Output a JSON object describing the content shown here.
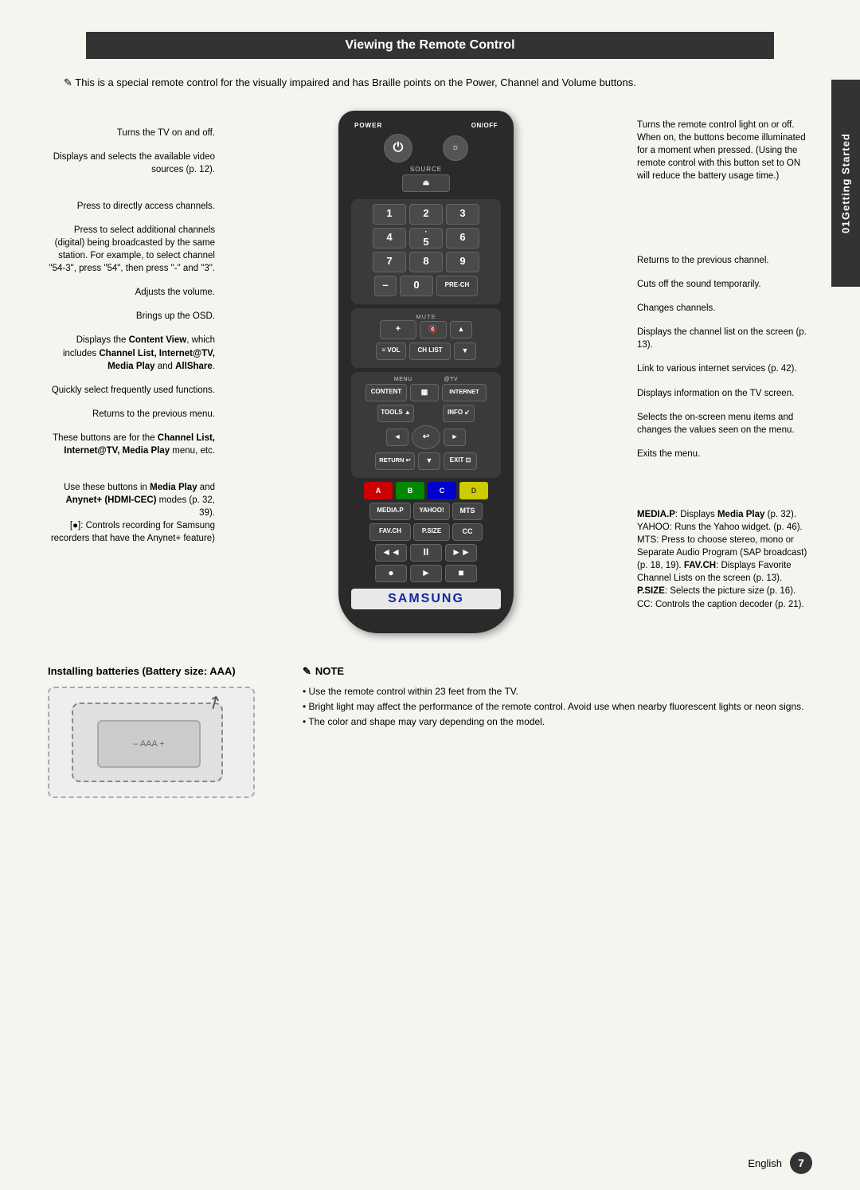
{
  "page": {
    "background": "#f5f5f0",
    "side_tab": {
      "number": "01",
      "text": "Getting Started"
    },
    "section_title": "Viewing the Remote Control",
    "intro_text": "This is a special remote control for the visually impaired and has Braille points on the Power, Channel and Volume buttons.",
    "left_labels": [
      {
        "text": "Turns the TV on and off."
      },
      {
        "text": "Displays and selects the available video sources (p. 12)."
      },
      {
        "text": "Press to directly access channels."
      },
      {
        "text": "Press to select additional channels (digital) being broadcasted by the same station. For example, to select channel \"54-3\", press \"54\", then press \"-\" and \"3\"."
      },
      {
        "text": "Adjusts the volume."
      },
      {
        "text": "Brings up the OSD."
      },
      {
        "text": "Displays the Content View, which includes Channel List, Internet@TV, Media Play and AllShare."
      },
      {
        "text": "Quickly select frequently used functions."
      },
      {
        "text": "Returns to the previous menu."
      },
      {
        "text": "These buttons are for the Channel List, Internet@TV, Media Play menu, etc."
      },
      {
        "text": "Use these buttons in Media Play and Anynet+ (HDMI-CEC) modes (p. 32, 39).\n[●]: Controls recording for Samsung recorders that have the Anynet+ feature)"
      }
    ],
    "right_labels": [
      {
        "text": "Turns the remote control light on or off. When on, the buttons become illuminated for a moment when pressed. (Using the remote control with this button set to ON will reduce the battery usage time.)"
      },
      {
        "text": "Returns to the previous channel."
      },
      {
        "text": "Cuts off the sound temporarily."
      },
      {
        "text": "Changes channels."
      },
      {
        "text": "Displays the channel list on the screen (p. 13)."
      },
      {
        "text": "Link to various internet services (p. 42)."
      },
      {
        "text": "Displays information on the TV screen."
      },
      {
        "text": "Selects the on-screen menu items and changes the values seen on the menu."
      },
      {
        "text": "Exits the menu."
      },
      {
        "text": "MEDIA.P: Displays Media Play (p. 32). YAHOO: Runs the Yahoo widget. (p. 46). MTS: Press to choose stereo, mono or Separate Audio Program (SAP broadcast) (p. 18, 19). FAV.CH: Displays Favorite Channel Lists on the screen (p. 13). P.SIZE: Selects the picture size (p. 16). CC: Controls the caption decoder (p. 21)."
      }
    ],
    "remote": {
      "power_label": "POWER",
      "onoff_label": "ON/OFF",
      "source_label": "SOURCE",
      "buttons": {
        "num1": "1",
        "num2": "2",
        "num3": "3",
        "num4": "4",
        "num5": "5",
        "num6": "6",
        "num7": "7",
        "num8": "8",
        "num9": "9",
        "dash": "–",
        "num0": "0",
        "prech": "PRE-CH",
        "mute": "MUTE",
        "vol": "VOL",
        "chlist": "CH LIST",
        "menu": "MENU",
        "atv": "@TV",
        "content": "CONTENT",
        "menu_icon": "▦",
        "internet": "INTERNET",
        "tools": "TOOLS",
        "info": "INFO",
        "up": "▲",
        "down": "▼",
        "left": "◄",
        "right": "►",
        "enter": "↩",
        "return": "RETURN",
        "exit": "EXIT",
        "a": "A",
        "b": "B",
        "c": "C",
        "d": "D",
        "mediap": "MEDIA.P",
        "yahoo": "YAHOO!",
        "mts": "MTS",
        "favch": "FAV.CH",
        "psize": "P.SIZE",
        "cc": "CC",
        "rew": "◄◄",
        "pause": "II",
        "ff": "►►",
        "rec": "●",
        "play": "►",
        "stop": "■"
      },
      "samsung": "SAMSUNG"
    },
    "batteries": {
      "title": "Installing batteries (Battery size: AAA)"
    },
    "note": {
      "title": "NOTE",
      "items": [
        "Use the remote control within 23 feet from the TV.",
        "Bright light may affect the performance of the remote control. Avoid use when nearby fluorescent lights or neon signs.",
        "The color and shape may vary depending on the model."
      ]
    },
    "footer": {
      "language": "English",
      "page_number": "7"
    }
  }
}
